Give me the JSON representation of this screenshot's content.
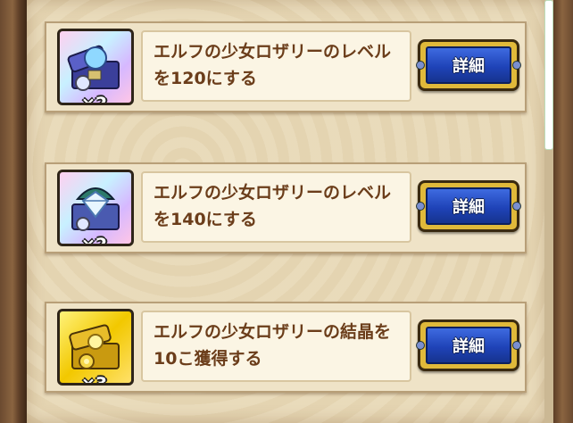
{
  "missions": [
    {
      "description": "エルフの少女ロザリーのレベルを120にする",
      "reward_icon": "sapphire-treasure-chest-icon",
      "reward_count": "×2",
      "button_label": "詳細"
    },
    {
      "description": "エルフの少女ロザリーのレベルを140にする",
      "reward_icon": "diamond-treasure-chest-icon",
      "reward_count": "×2",
      "button_label": "詳細"
    },
    {
      "description": "エルフの少女ロザリーの結晶を10こ獲得する",
      "reward_icon": "gold-treasure-chest-icon",
      "reward_count": "×3",
      "button_label": "詳細"
    }
  ],
  "colors": {
    "description_text": "#6b3d1a",
    "button_blue": "#1f43b8",
    "button_frame": "#e0b93a"
  }
}
